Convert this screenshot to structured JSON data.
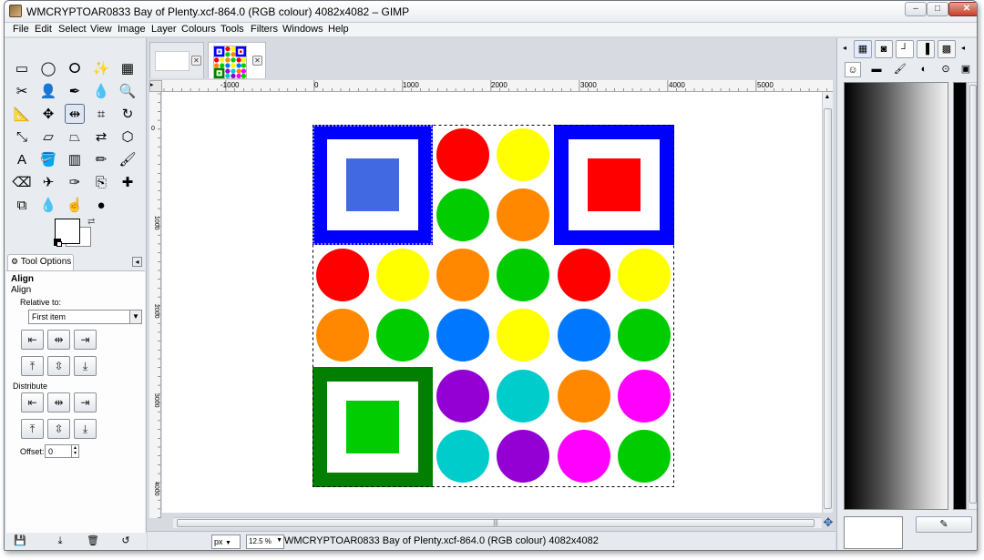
{
  "window": {
    "title": "WMCRYPTOAR0833 Bay of Plenty.xcf-864.0 (RGB colour) 4082x4082 – GIMP",
    "minimize_glyph": "–",
    "maximize_glyph": "□",
    "close_glyph": "✕"
  },
  "menubar": {
    "items": [
      "File",
      "Edit",
      "Select",
      "View",
      "Image",
      "Layer",
      "Colours",
      "Tools",
      "Filters",
      "Windows",
      "Help"
    ]
  },
  "toolbox": {
    "tools": [
      {
        "icon": "rect-select-icon",
        "glyph": "▭"
      },
      {
        "icon": "ellipse-select-icon",
        "glyph": "◯"
      },
      {
        "icon": "free-select-icon",
        "glyph": "ⵔ"
      },
      {
        "icon": "fuzzy-select-icon",
        "glyph": "✨"
      },
      {
        "icon": "color-select-icon",
        "glyph": "▦"
      },
      {
        "icon": "scissors-select-icon",
        "glyph": "✂"
      },
      {
        "icon": "foreground-select-icon",
        "glyph": "👤"
      },
      {
        "icon": "paths-icon",
        "glyph": "✒"
      },
      {
        "icon": "color-picker-icon",
        "glyph": "💧"
      },
      {
        "icon": "zoom-icon",
        "glyph": "🔍"
      },
      {
        "icon": "measure-icon",
        "glyph": "📐"
      },
      {
        "icon": "move-icon",
        "glyph": "✥"
      },
      {
        "icon": "align-icon",
        "glyph": "⇹"
      },
      {
        "icon": "crop-icon",
        "glyph": "⌗"
      },
      {
        "icon": "rotate-icon",
        "glyph": "↻"
      },
      {
        "icon": "scale-icon",
        "glyph": "⤡"
      },
      {
        "icon": "shear-icon",
        "glyph": "▱"
      },
      {
        "icon": "perspective-icon",
        "glyph": "⏢"
      },
      {
        "icon": "flip-icon",
        "glyph": "⇄"
      },
      {
        "icon": "cage-icon",
        "glyph": "⬡"
      },
      {
        "icon": "text-icon",
        "glyph": "A"
      },
      {
        "icon": "bucket-fill-icon",
        "glyph": "🪣"
      },
      {
        "icon": "blend-icon",
        "glyph": "▥"
      },
      {
        "icon": "pencil-icon",
        "glyph": "✏"
      },
      {
        "icon": "paintbrush-icon",
        "glyph": "🖌"
      },
      {
        "icon": "eraser-icon",
        "glyph": "⌫"
      },
      {
        "icon": "airbrush-icon",
        "glyph": "✈"
      },
      {
        "icon": "ink-icon",
        "glyph": "✑"
      },
      {
        "icon": "clone-icon",
        "glyph": "⎘"
      },
      {
        "icon": "heal-icon",
        "glyph": "✚"
      },
      {
        "icon": "perspective-clone-icon",
        "glyph": "⧉"
      },
      {
        "icon": "blur-icon",
        "glyph": "💧"
      },
      {
        "icon": "smudge-icon",
        "glyph": "☝"
      },
      {
        "icon": "dodge-burn-icon",
        "glyph": "●"
      }
    ],
    "swap_glyph": "⇄"
  },
  "tool_options": {
    "tab_label": "Tool Options",
    "heading": "Align",
    "subheading": "Align",
    "relative_label": "Relative to:",
    "relative_value": "First item",
    "distribute_label": "Distribute",
    "offset_label": "Offset:",
    "offset_value": "0",
    "align_buttons": [
      "⇤",
      "⇹",
      "⇥",
      "⤒",
      "⇳",
      "⤓"
    ],
    "distribute_buttons": [
      "⇤",
      "⇹",
      "⇥",
      "⤒",
      "⇳",
      "⤓"
    ]
  },
  "canvas": {
    "hruler_labels": [
      "-1000",
      "0",
      "1000",
      "2000",
      "3000",
      "4000",
      "5000"
    ],
    "vruler_labels": [
      "0",
      "1000",
      "2000",
      "3000",
      "4000"
    ],
    "scroll_grip": "|||"
  },
  "image": {
    "colors": {
      "blue": "#0000ff",
      "royal_blue": "#4169e1",
      "red": "#ff0000",
      "yellow": "#ffff00",
      "green": "#00cc00",
      "dark_green": "#007f00",
      "orange": "#ff8800",
      "azure": "#0077ff",
      "purple": "#9400d3",
      "cyan": "#00cccc",
      "magenta": "#ff00ff"
    }
  },
  "status": {
    "unit": "px",
    "zoom": "12.5 %",
    "text": "WMCRYPTOAR0833 Bay of Plenty.xcf-864.0 (RGB colour) 4082x4082"
  },
  "right_panel": {
    "top_tabs": [
      "▦",
      "◙",
      "┘",
      "▐",
      "▩"
    ],
    "sub_tabs": [
      "☺",
      "▬",
      "🖌",
      "◐",
      "⊙",
      "▣"
    ]
  }
}
